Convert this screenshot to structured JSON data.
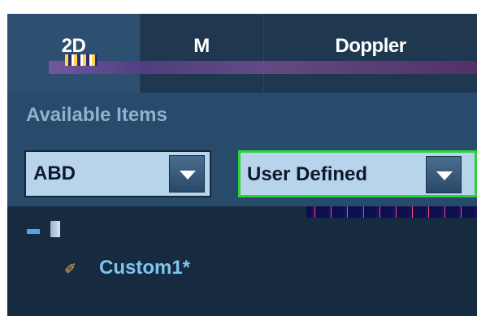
{
  "tabs": [
    {
      "label": "2D"
    },
    {
      "label": "M"
    },
    {
      "label": "Doppler"
    }
  ],
  "panel": {
    "title": "Available Items"
  },
  "dropdowns": {
    "exam": {
      "value": "ABD"
    },
    "preset": {
      "value": "User Defined"
    }
  },
  "tree": {
    "items": [
      {
        "label": "Custom1*"
      }
    ]
  },
  "colors": {
    "accent_border": "#2cd23a",
    "panel_bg": "#284a6b",
    "tree_label": "#7dc5f0"
  }
}
